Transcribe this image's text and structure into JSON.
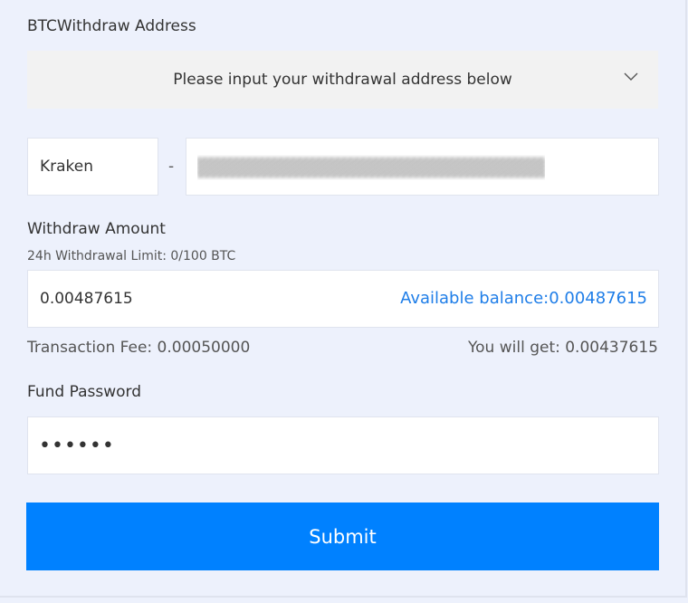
{
  "address_section": {
    "title": "BTCWithdraw Address",
    "select_placeholder": "Please input your withdrawal address below",
    "exchange_label": "Kraken",
    "separator": "-"
  },
  "amount_section": {
    "title": "Withdraw Amount",
    "limit_text": "24h Withdrawal Limit: 0/100 BTC",
    "amount_value": "0.00487615",
    "available_balance": "Available balance:0.00487615",
    "transaction_fee": "Transaction Fee: 0.00050000",
    "you_will_get": "You will get: 0.00437615"
  },
  "password_section": {
    "title": "Fund Password",
    "masked_value": "••••••"
  },
  "submit_label": "Submit",
  "colors": {
    "page_bg": "#edf1fc",
    "select_bg": "#f2f2f2",
    "accent_blue": "#0081ff",
    "link_blue": "#1f7ee8"
  },
  "icons": {
    "dropdown": "chevron-down-icon"
  }
}
